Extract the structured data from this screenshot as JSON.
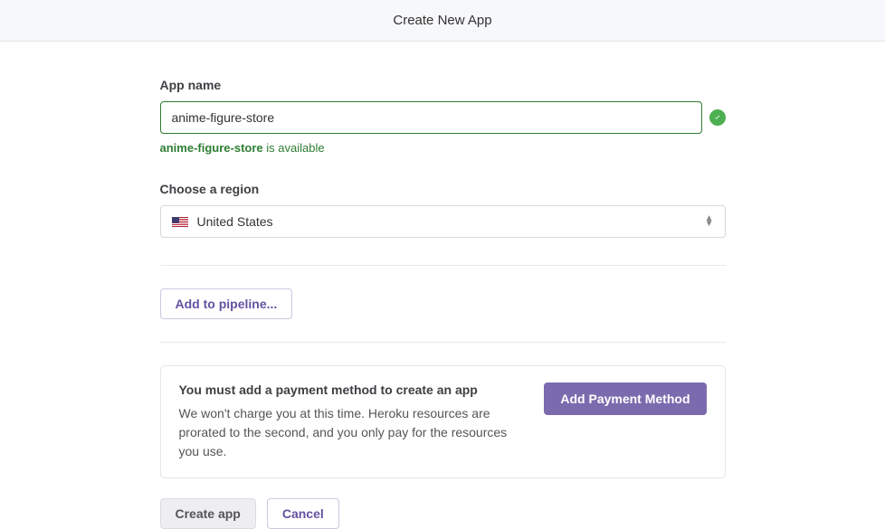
{
  "header": {
    "title": "Create New App"
  },
  "form": {
    "appName": {
      "label": "App name",
      "value": "anime-figure-store",
      "availabilityPrefix": "anime-figure-store",
      "availabilitySuffix": " is available"
    },
    "region": {
      "label": "Choose a region",
      "selected": "United States"
    },
    "pipeline": {
      "buttonLabel": "Add to pipeline..."
    },
    "payment": {
      "title": "You must add a payment method to create an app",
      "description": "We won't charge you at this time. Heroku resources are prorated to the second, and you only pay for the resources you use.",
      "buttonLabel": "Add Payment Method"
    },
    "actions": {
      "create": "Create app",
      "cancel": "Cancel"
    }
  }
}
